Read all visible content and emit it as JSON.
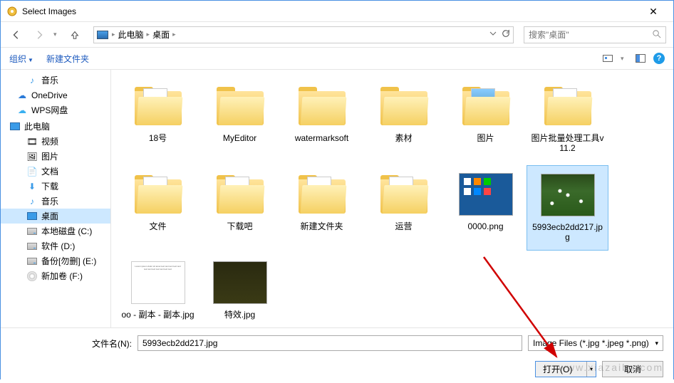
{
  "window": {
    "title": "Select Images"
  },
  "nav": {
    "crumbs": [
      "此电脑",
      "桌面"
    ],
    "search_placeholder": "搜索\"桌面\""
  },
  "toolbar": {
    "organize": "组织",
    "new_folder": "新建文件夹"
  },
  "sidebar": {
    "items": [
      {
        "label": "音乐",
        "icon": "music",
        "lvl": 2
      },
      {
        "label": "OneDrive",
        "icon": "cloud-b",
        "lvl": 1
      },
      {
        "label": "WPS网盘",
        "icon": "cloud-lb",
        "lvl": 1
      },
      {
        "label": "此电脑",
        "icon": "pc",
        "lvl": 0,
        "head": true
      },
      {
        "label": "视频",
        "icon": "film",
        "lvl": 2
      },
      {
        "label": "图片",
        "icon": "pic",
        "lvl": 2
      },
      {
        "label": "文档",
        "icon": "doc",
        "lvl": 2
      },
      {
        "label": "下载",
        "icon": "dl",
        "lvl": 2
      },
      {
        "label": "音乐",
        "icon": "music",
        "lvl": 2
      },
      {
        "label": "桌面",
        "icon": "desktop",
        "lvl": 2,
        "selected": true
      },
      {
        "label": "本地磁盘 (C:)",
        "icon": "drive",
        "lvl": 2
      },
      {
        "label": "软件 (D:)",
        "icon": "drive",
        "lvl": 2
      },
      {
        "label": "备份[勿删] (E:)",
        "icon": "drive",
        "lvl": 2
      },
      {
        "label": "新加卷 (F:)",
        "icon": "cd",
        "lvl": 2
      }
    ]
  },
  "files": [
    {
      "label": "18号",
      "type": "folder-doc"
    },
    {
      "label": "MyEditor",
      "type": "folder"
    },
    {
      "label": "watermarksoft",
      "type": "folder"
    },
    {
      "label": "素材",
      "type": "folder"
    },
    {
      "label": "图片",
      "type": "folder-img"
    },
    {
      "label": "图片批量处理工具v11.2",
      "type": "folder-doc"
    },
    {
      "label": "文件",
      "type": "folder-doc"
    },
    {
      "label": "下载吧",
      "type": "folder-doc"
    },
    {
      "label": "新建文件夹",
      "type": "folder-doc"
    },
    {
      "label": "运营",
      "type": "folder-doc"
    },
    {
      "label": "0000.png",
      "type": "img-desktop"
    },
    {
      "label": "5993ecb2dd217.jpg",
      "type": "img-grass",
      "selected": true
    },
    {
      "label": "oo - 副本 - 副本.jpg",
      "type": "img-doc"
    },
    {
      "label": "特效.jpg",
      "type": "img-dark"
    }
  ],
  "footer": {
    "filename_label": "文件名(N):",
    "filename_value": "5993ecb2dd217.jpg",
    "filter": "Image Files (*.jpg *.jpeg *.png)",
    "open": "打开(O)",
    "cancel": "取消"
  },
  "watermark": "www.xiazaiba.com"
}
